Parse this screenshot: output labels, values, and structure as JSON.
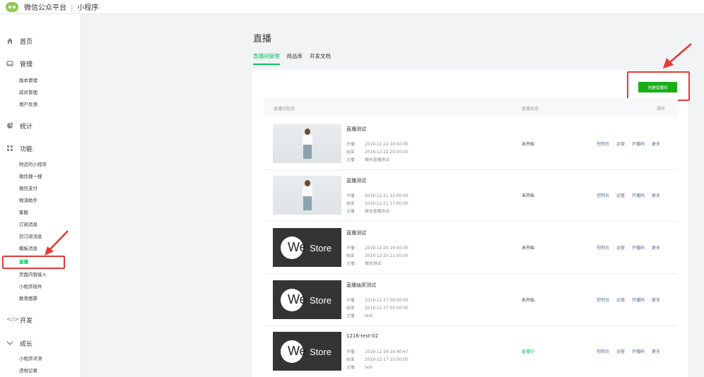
{
  "header": {
    "brand": "微信公众平台",
    "product": "小程序",
    "separator": "|"
  },
  "sidebar": {
    "groups": [
      {
        "label": "首页",
        "icon": "home-icon"
      },
      {
        "label": "管理",
        "icon": "inbox-icon",
        "items": [
          "版本管理",
          "成员管理",
          "用户反馈"
        ]
      },
      {
        "label": "统计",
        "icon": "pie-chart-icon"
      },
      {
        "label": "功能",
        "icon": "grid-icon",
        "items": [
          "附近的小程序",
          "微信搜一搜",
          "微信支付",
          "物流助手",
          "客服",
          "订阅消息",
          "旧订阅消息",
          "模板消息",
          "直播",
          "页面内容接入",
          "小程序插件",
          "教育图票"
        ]
      },
      {
        "label": "开发",
        "icon": "code-icon"
      },
      {
        "label": "成长",
        "icon": "growth-icon",
        "items": [
          "小程序评测",
          "违规记录"
        ]
      }
    ],
    "active_item": "直播"
  },
  "main": {
    "title": "直播",
    "tabs": [
      "直播间管理",
      "商品库",
      "开发文档"
    ],
    "active_tab": "直播间管理",
    "create_button": "创建直播间",
    "columns": {
      "info": "直播间信息",
      "status": "直播状态",
      "ops": "操作"
    },
    "field_labels": {
      "start": "开播",
      "end": "结束",
      "anchor": "主播"
    },
    "ops": [
      "控制台",
      "运营",
      "开播码",
      "更多"
    ],
    "rows": [
      {
        "title": "直播测试",
        "start": "2019-12-22 18:00:00",
        "end": "2019-12-22 20:00:00",
        "anchor": "微信直播测试",
        "status": "未开始",
        "thumb": "photo"
      },
      {
        "title": "直播测试",
        "start": "2019-12-21 12:00:00",
        "end": "2019-12-21 17:00:00",
        "anchor": "微信直播测试",
        "status": "未开始",
        "thumb": "photo"
      },
      {
        "title": "直播测试",
        "start": "2019-12-20 19:00:00",
        "end": "2019-12-20 21:00:00",
        "anchor": "微信测试",
        "status": "未开始",
        "thumb": "westore"
      },
      {
        "title": "直播抽奖测试",
        "start": "2019-12-17 00:00:00",
        "end": "2019-12-17 05:00:00",
        "anchor": "test",
        "status": "未开始",
        "thumb": "westore"
      },
      {
        "title": "1216-test-02",
        "start": "2019-12-16 16:40:47",
        "end": "2019-12-17 10:00:00",
        "anchor": "test",
        "status": "直播中",
        "thumb": "westore"
      }
    ],
    "thumb_text": {
      "we": "We",
      "store": "Store"
    }
  }
}
